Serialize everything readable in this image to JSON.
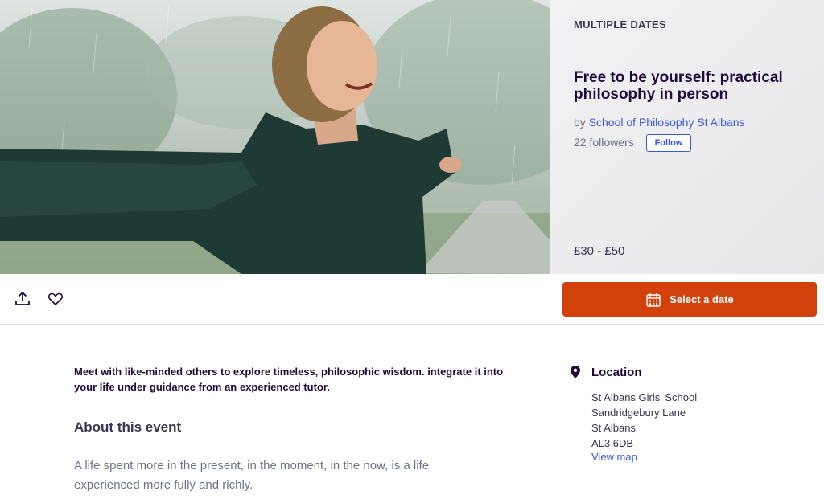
{
  "hero": {
    "eyebrow": "MULTIPLE DATES",
    "title": "Free to be yourself: practical philosophy in person",
    "by_prefix": "by",
    "organizer": "School of Philosophy St Albans",
    "followers": "22 followers",
    "follow_label": "Follow",
    "price": "£30 - £50"
  },
  "actions": {
    "share_icon": "share-icon",
    "like_icon": "heart-icon",
    "select_date_label": "Select a date",
    "calendar_icon": "calendar-icon",
    "accent_color": "#d1410c"
  },
  "content": {
    "summary": "Meet with like-minded others to explore timeless, philosophic wisdom. integrate it into your life under guidance from an experienced tutor.",
    "about_heading": "About this event",
    "about_text": "A life spent more in the present, in the moment, in the now, is a life experienced more fully and richly."
  },
  "location": {
    "heading": "Location",
    "address": [
      "St Albans Girls' School",
      "Sandridgebury Lane",
      "St Albans",
      "AL3 6DB"
    ],
    "view_map": "View map",
    "pin_icon": "map-pin-icon"
  },
  "colors": {
    "link": "#3659e3",
    "heading": "#1e0a3c"
  }
}
